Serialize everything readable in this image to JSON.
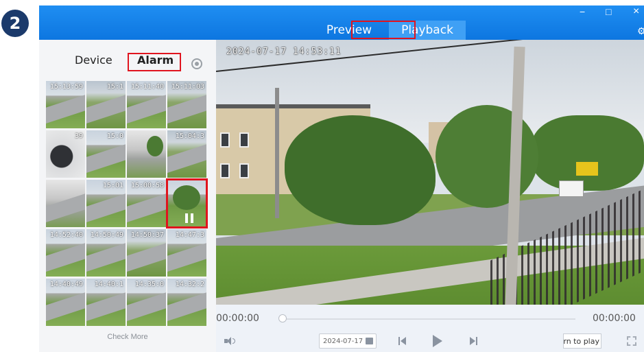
{
  "step_badge": "2",
  "header": {
    "tabs": [
      {
        "label": "Preview"
      },
      {
        "label": "Playback",
        "active": true
      }
    ],
    "window_controls": {
      "minimize": "−",
      "maximize": "□",
      "close": "×"
    },
    "accent_color": "#1a86ea"
  },
  "sidebar": {
    "tabs": [
      {
        "label": "Device"
      },
      {
        "label": "Alarm",
        "active": true
      }
    ],
    "refresh_icon": "refresh-icon",
    "thumbnails": [
      {
        "time": "15:13:59"
      },
      {
        "time": "15:1"
      },
      {
        "time": "15:11:40"
      },
      {
        "time": "15:11:03"
      },
      {
        "time": "39"
      },
      {
        "time": "15:0"
      },
      {
        "time": ""
      },
      {
        "time": "15:04:3"
      },
      {
        "time": ""
      },
      {
        "time": "15:01"
      },
      {
        "time": "15:00:58"
      },
      {
        "time": "",
        "selected": true
      },
      {
        "time": "14:52:40"
      },
      {
        "time": "14:50:49"
      },
      {
        "time": "14:50:37"
      },
      {
        "time": "14:47:3"
      },
      {
        "time": "14:40:49"
      },
      {
        "time": "14:40:1"
      },
      {
        "time": "14:35:0"
      },
      {
        "time": "14:32:2"
      }
    ],
    "check_more": "Check More"
  },
  "video": {
    "osd_timestamp": "2024-07-17 14:53:11"
  },
  "controls": {
    "time_start": "00:00:00",
    "time_end": "00:00:00",
    "date": "2024-07-17",
    "turn_to_play": "rn to play",
    "icons": [
      "speaker-icon",
      "calendar-icon",
      "prev-icon",
      "play-icon",
      "next-icon",
      "fullscreen-icon"
    ]
  },
  "highlight_color": "#e0141e"
}
